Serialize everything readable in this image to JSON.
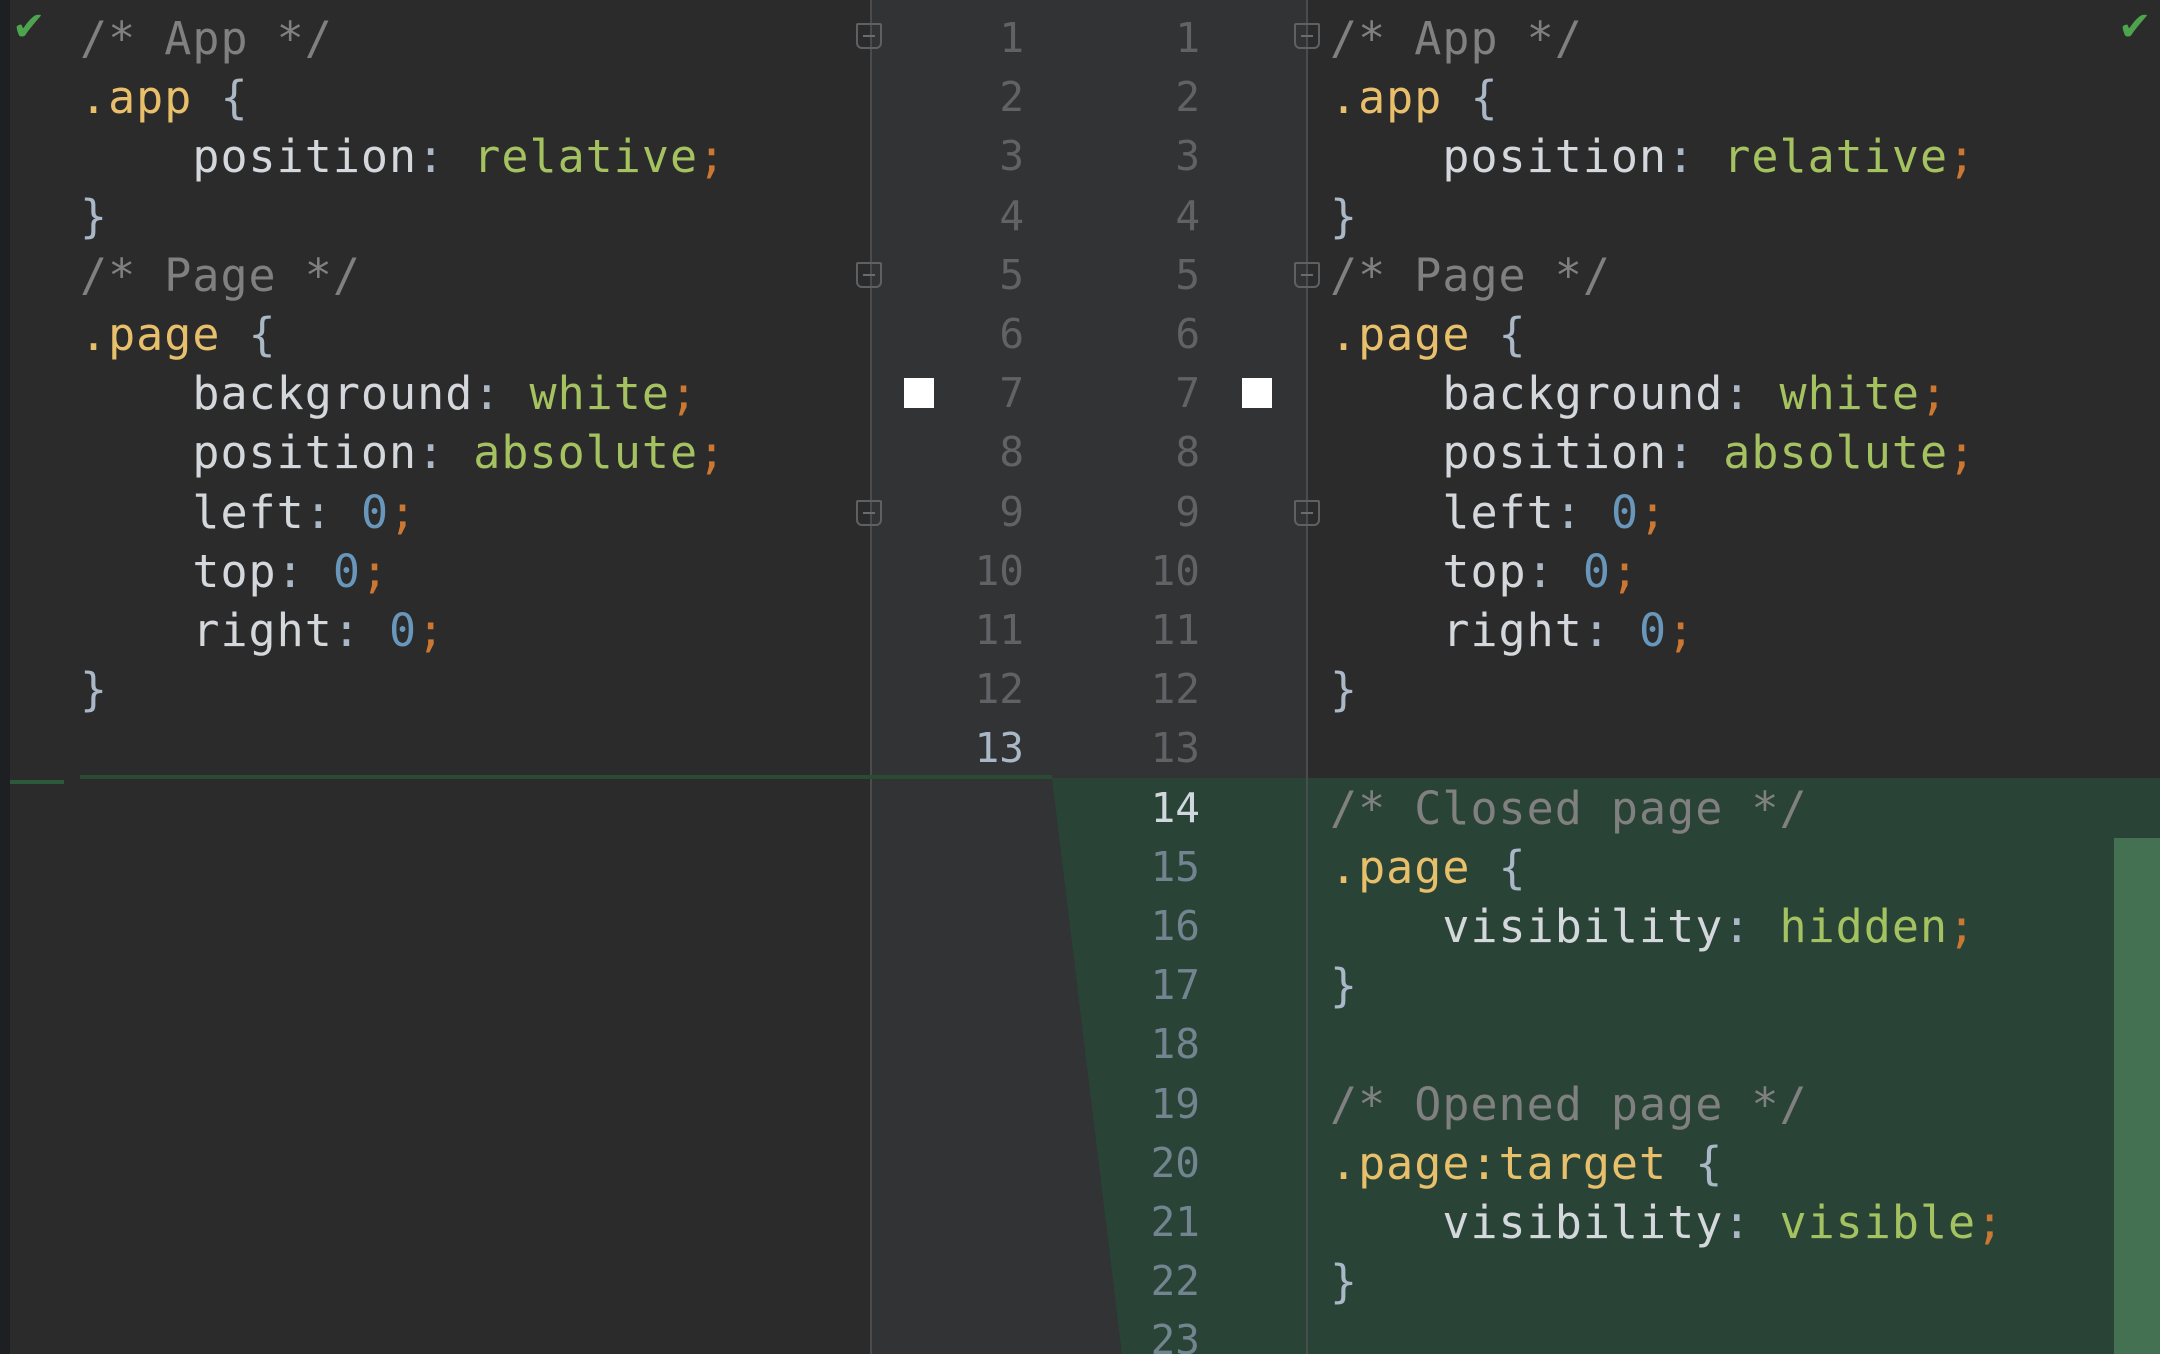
{
  "left_pane": {
    "lines": [
      [
        {
          "t": "/* App */",
          "c": "comment"
        }
      ],
      [
        {
          "t": ".app",
          "c": "selector"
        },
        {
          "t": " {",
          "c": "punct"
        }
      ],
      [
        {
          "t": "    position",
          "c": "prop"
        },
        {
          "t": ": ",
          "c": "punct"
        },
        {
          "t": "relative",
          "c": "value"
        },
        {
          "t": ";",
          "c": "semi"
        }
      ],
      [
        {
          "t": "}",
          "c": "punct"
        }
      ],
      [
        {
          "t": "/* Page */",
          "c": "comment"
        }
      ],
      [
        {
          "t": ".page",
          "c": "selector"
        },
        {
          "t": " {",
          "c": "punct"
        }
      ],
      [
        {
          "t": "    background",
          "c": "prop"
        },
        {
          "t": ": ",
          "c": "punct"
        },
        {
          "t": "white",
          "c": "value"
        },
        {
          "t": ";",
          "c": "semi"
        }
      ],
      [
        {
          "t": "    position",
          "c": "prop"
        },
        {
          "t": ": ",
          "c": "punct"
        },
        {
          "t": "absolute",
          "c": "value"
        },
        {
          "t": ";",
          "c": "semi"
        }
      ],
      [
        {
          "t": "    left",
          "c": "prop"
        },
        {
          "t": ": ",
          "c": "punct"
        },
        {
          "t": "0",
          "c": "num"
        },
        {
          "t": ";",
          "c": "semi"
        }
      ],
      [
        {
          "t": "    top",
          "c": "prop"
        },
        {
          "t": ": ",
          "c": "punct"
        },
        {
          "t": "0",
          "c": "num"
        },
        {
          "t": ";",
          "c": "semi"
        }
      ],
      [
        {
          "t": "    right",
          "c": "prop"
        },
        {
          "t": ": ",
          "c": "punct"
        },
        {
          "t": "0",
          "c": "num"
        },
        {
          "t": ";",
          "c": "semi"
        }
      ],
      [
        {
          "t": "}",
          "c": "punct"
        }
      ],
      []
    ],
    "line_numbers": [
      "1",
      "2",
      "3",
      "4",
      "5",
      "6",
      "7",
      "8",
      "9",
      "10",
      "11",
      "12",
      "13"
    ],
    "current_line": "13"
  },
  "right_pane": {
    "lines": [
      [
        {
          "t": "/* App */",
          "c": "comment"
        }
      ],
      [
        {
          "t": ".app",
          "c": "selector"
        },
        {
          "t": " {",
          "c": "punct"
        }
      ],
      [
        {
          "t": "    position",
          "c": "prop"
        },
        {
          "t": ": ",
          "c": "punct"
        },
        {
          "t": "relative",
          "c": "value"
        },
        {
          "t": ";",
          "c": "semi"
        }
      ],
      [
        {
          "t": "}",
          "c": "punct"
        }
      ],
      [
        {
          "t": "/* Page */",
          "c": "comment"
        }
      ],
      [
        {
          "t": ".page",
          "c": "selector"
        },
        {
          "t": " {",
          "c": "punct"
        }
      ],
      [
        {
          "t": "    background",
          "c": "prop"
        },
        {
          "t": ": ",
          "c": "punct"
        },
        {
          "t": "white",
          "c": "value"
        },
        {
          "t": ";",
          "c": "semi"
        }
      ],
      [
        {
          "t": "    position",
          "c": "prop"
        },
        {
          "t": ": ",
          "c": "punct"
        },
        {
          "t": "absolute",
          "c": "value"
        },
        {
          "t": ";",
          "c": "semi"
        }
      ],
      [
        {
          "t": "    left",
          "c": "prop"
        },
        {
          "t": ": ",
          "c": "punct"
        },
        {
          "t": "0",
          "c": "num"
        },
        {
          "t": ";",
          "c": "semi"
        }
      ],
      [
        {
          "t": "    top",
          "c": "prop"
        },
        {
          "t": ": ",
          "c": "punct"
        },
        {
          "t": "0",
          "c": "num"
        },
        {
          "t": ";",
          "c": "semi"
        }
      ],
      [
        {
          "t": "    right",
          "c": "prop"
        },
        {
          "t": ": ",
          "c": "punct"
        },
        {
          "t": "0",
          "c": "num"
        },
        {
          "t": ";",
          "c": "semi"
        }
      ],
      [
        {
          "t": "}",
          "c": "punct"
        }
      ],
      [],
      [
        {
          "t": "/* Closed page */",
          "c": "comment"
        }
      ],
      [
        {
          "t": ".page",
          "c": "selector"
        },
        {
          "t": " {",
          "c": "punct"
        }
      ],
      [
        {
          "t": "    visibility",
          "c": "prop"
        },
        {
          "t": ": ",
          "c": "punct"
        },
        {
          "t": "hidden",
          "c": "value"
        },
        {
          "t": ";",
          "c": "semi"
        }
      ],
      [
        {
          "t": "}",
          "c": "punct"
        }
      ],
      [],
      [
        {
          "t": "/* Opened page */",
          "c": "comment"
        }
      ],
      [
        {
          "t": ".page:target",
          "c": "selector"
        },
        {
          "t": " {",
          "c": "punct"
        }
      ],
      [
        {
          "t": "    visibility",
          "c": "prop"
        },
        {
          "t": ": ",
          "c": "punct"
        },
        {
          "t": "visible",
          "c": "value"
        },
        {
          "t": ";",
          "c": "semi"
        }
      ],
      [
        {
          "t": "}",
          "c": "punct"
        }
      ],
      []
    ],
    "line_numbers": [
      "1",
      "2",
      "3",
      "4",
      "5",
      "6",
      "7",
      "8",
      "9",
      "10",
      "11",
      "12",
      "13",
      "14",
      "15",
      "16",
      "17",
      "18",
      "19",
      "20",
      "21",
      "22",
      "23"
    ],
    "current_line": "14",
    "inserted_from": "14"
  },
  "colors": {
    "comment": "#808080",
    "selector": "#e8bf6a",
    "value": "#a5c261",
    "number": "#6897bb",
    "semicolon": "#cc7832",
    "inserted_background": "#294436",
    "inserted_marker": "#447152"
  },
  "icons": {
    "status": "check-icon",
    "fold": "fold-icon",
    "checkbox": "checkbox-icon"
  }
}
